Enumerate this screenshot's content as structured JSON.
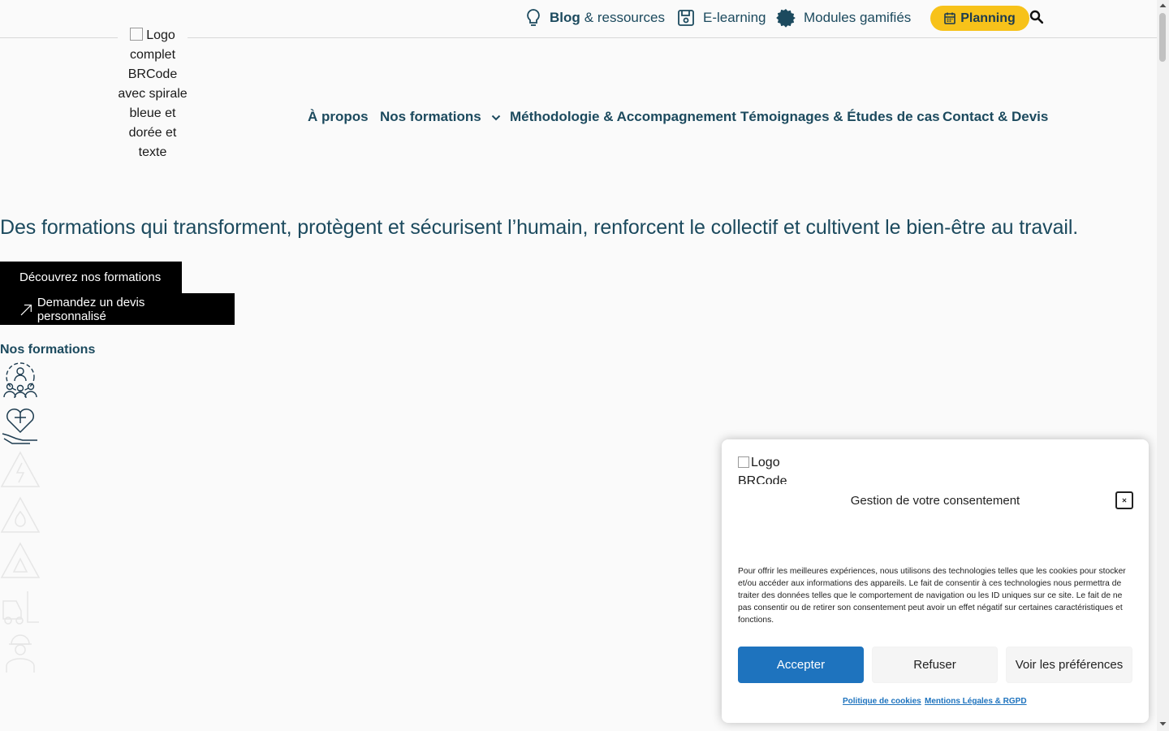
{
  "topbar": {
    "blog_bold": "Blog",
    "blog_rest": "& ressources",
    "elearning": "E-learning",
    "gamified": "Modules gamifiés",
    "planning": "Planning"
  },
  "logo": {
    "alt": "Logo complet BRCode avec spirale bleue et dorée et texte"
  },
  "nav": {
    "about": "À propos",
    "formations": "Nos formations",
    "methodology": "Méthodologie & Accompagnement",
    "testimonials": "Témoignages & Études de cas",
    "contact": "Contact & Devis"
  },
  "hero": {
    "title": "Des formations qui transforment, protègent et sécurisent l’humain, renforcent le collectif et cultivent le bien-être au travail.",
    "btn_discover": "Découvrez nos formations",
    "btn_quote": "Demandez un devis personnalisé"
  },
  "formations": {
    "title": "Nos formations"
  },
  "cookie": {
    "logo_alt": "Logo BRCode avec",
    "title": "Gestion de votre consentement",
    "text": "Pour offrir les meilleures expériences, nous utilisons des technologies telles que les cookies pour stocker et/ou accéder aux informations des appareils. Le fait de consentir à ces technologies nous permettra de traiter des données telles que le comportement de navigation ou les ID uniques sur ce site. Le fait de ne pas consentir ou de retirer son consentement peut avoir un effet négatif sur certaines caractéristiques et fonctions.",
    "accept": "Accepter",
    "refuse": "Refuser",
    "preferences": "Voir les préférences",
    "cookie_policy": "Politique de cookies",
    "legal": "Mentions Légales & RGPD"
  },
  "colors": {
    "brand_blue": "#1c4a5e",
    "planning_yellow": "#f7c21a",
    "accept_blue": "#1e73be"
  }
}
